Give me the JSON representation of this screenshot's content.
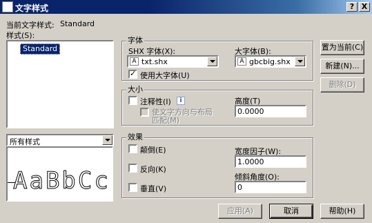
{
  "window": {
    "title": "文字样式",
    "help_btn": "?",
    "close_btn": "X"
  },
  "current_style": {
    "label": "当前文字样式:",
    "value": "Standard"
  },
  "styles": {
    "label": "样式(S):",
    "items": [
      "Standard"
    ]
  },
  "filter": {
    "value": "所有样式"
  },
  "preview": {
    "text": "AaBbCc"
  },
  "font_group": {
    "title": "字体",
    "shx_label": "SHX 字体(X):",
    "shx_value": "txt.shx",
    "big_label": "大字体(B):",
    "big_value": "gbcbig.shx",
    "use_big_label": "使用大字体(U)",
    "use_big_checked": true
  },
  "size_group": {
    "title": "大小",
    "annotative_label": "注释性(I)",
    "annotative_checked": false,
    "orient_label_1": "使文字方向与布局",
    "orient_label_2": "匹配(M)",
    "height_label": "高度(T)",
    "height_value": "0.0000"
  },
  "effects_group": {
    "title": "效果",
    "upside_down": "颠倒(E)",
    "backwards": "反向(K)",
    "vertical": "垂直(V)",
    "width_label": "宽度因子(W):",
    "width_value": "1.0000",
    "oblique_label": "倾斜角度(O):",
    "oblique_value": "0"
  },
  "buttons": {
    "set_current": "置为当前(C)",
    "new": "新建(N)...",
    "delete": "删除(D)",
    "apply": "应用(A)",
    "cancel": "取消",
    "help": "帮助(H)"
  }
}
